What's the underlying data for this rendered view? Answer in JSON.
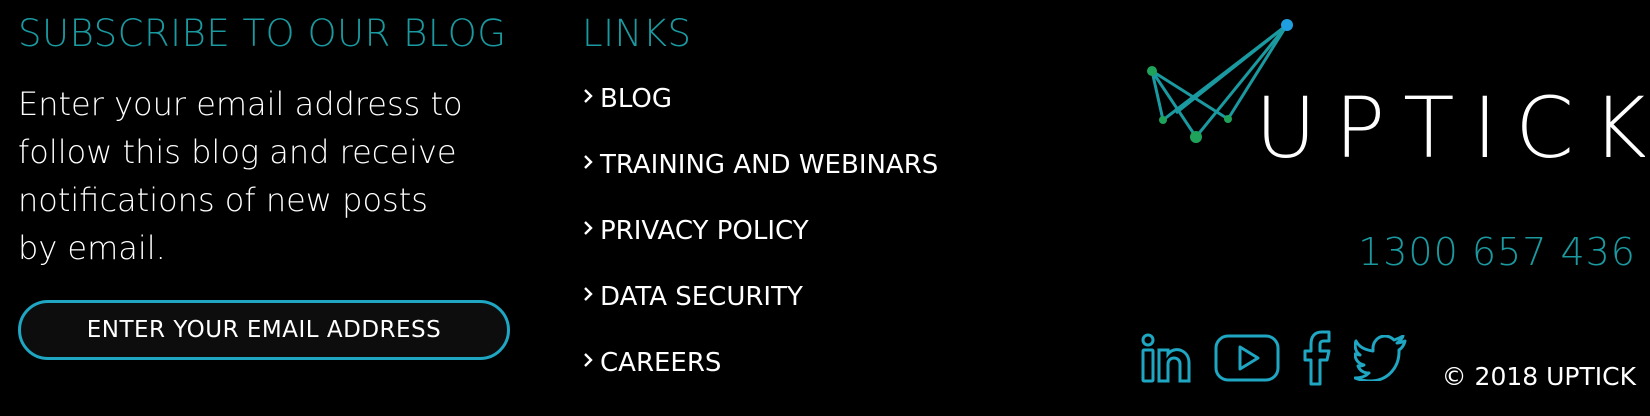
{
  "subscribe": {
    "heading": "SUBSCRIBE TO OUR BLOG",
    "description_lines": [
      "Enter your email address to",
      "follow this blog and receive",
      "notifications of new posts",
      "by email."
    ],
    "email_placeholder": "ENTER YOUR EMAIL ADDRESS"
  },
  "links": {
    "heading": "LINKS",
    "items": [
      {
        "label": "BLOG"
      },
      {
        "label": "TRAINING AND WEBINARS"
      },
      {
        "label": "PRIVACY POLICY"
      },
      {
        "label": "DATA SECURITY"
      },
      {
        "label": "CAREERS"
      }
    ]
  },
  "brand": {
    "logo_text": "UPTICK",
    "phone": "1300 657 436",
    "social": [
      {
        "icon": "linkedin-icon"
      },
      {
        "icon": "youtube-icon"
      },
      {
        "icon": "facebook-icon"
      },
      {
        "icon": "twitter-icon"
      }
    ],
    "copyright": "© 2018 UPTICK"
  },
  "colors": {
    "background": "#000000",
    "accent_teal": "#1a9aa0",
    "accent_blue": "#1fa6c2",
    "logo_green": "#1fa35a",
    "text": "#ffffff"
  }
}
